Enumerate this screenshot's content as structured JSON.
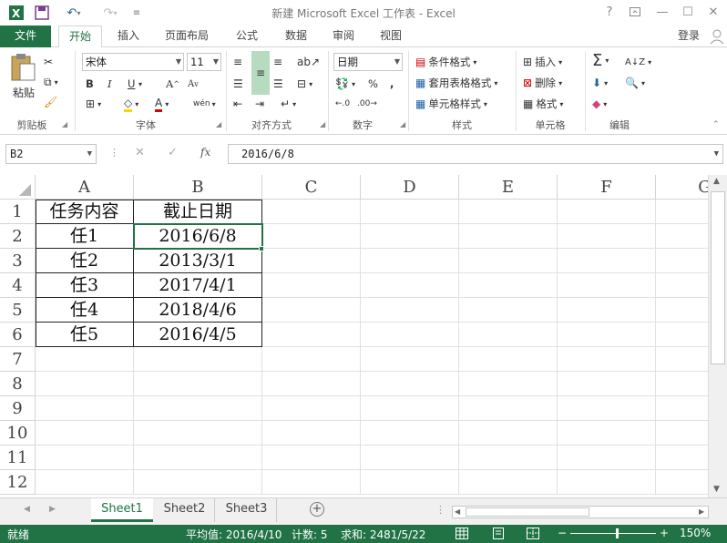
{
  "title": "新建 Microsoft Excel 工作表 - Excel",
  "quick_access": {
    "excel_icon": "excel-logo-icon",
    "save_icon": "save-icon",
    "undo_icon": "undo-icon",
    "redo_icon": "redo-icon",
    "customize_icon": "customize-icon"
  },
  "window_controls": {
    "help": "?",
    "ribbon_display": "ribbon-display-icon",
    "minimize": "minimize-icon",
    "maximize": "maximize-icon",
    "close": "close-icon"
  },
  "tabs": [
    "文件",
    "开始",
    "插入",
    "页面布局",
    "公式",
    "数据",
    "审阅",
    "视图"
  ],
  "login": "登录",
  "ribbon": {
    "clipboard": {
      "paste": "粘贴",
      "label": "剪贴板"
    },
    "font": {
      "name": "宋体",
      "size": "11",
      "bold": "B",
      "italic": "I",
      "underline": "U",
      "grow": "A",
      "shrink": "A",
      "label": "字体"
    },
    "alignment": {
      "label": "对齐方式"
    },
    "number": {
      "format": "日期",
      "label": "数字",
      "percent": "%",
      "comma": ","
    },
    "styles": {
      "conditional": "条件格式",
      "table": "套用表格格式",
      "cell_styles": "单元格样式",
      "label": "样式"
    },
    "cells": {
      "insert": "插入",
      "delete": "删除",
      "format": "格式",
      "label": "单元格"
    },
    "editing": {
      "label": "编辑"
    }
  },
  "formula_bar": {
    "name_box": "B2",
    "fx": "fx",
    "value": "2016/6/8"
  },
  "columns": [
    "A",
    "B",
    "C",
    "D",
    "E",
    "F",
    "G"
  ],
  "rows": [
    "1",
    "2",
    "3",
    "4",
    "5",
    "6",
    "7",
    "8",
    "9",
    "10",
    "11",
    "12"
  ],
  "table": {
    "headers": [
      "任务内容",
      "截止日期"
    ],
    "data": [
      [
        "任1",
        "2016/6/8"
      ],
      [
        "任2",
        "2013/3/1"
      ],
      [
        "任3",
        "2017/4/1"
      ],
      [
        "任4",
        "2018/4/6"
      ],
      [
        "任5",
        "2016/4/5"
      ]
    ]
  },
  "sheets": [
    "Sheet1",
    "Sheet2",
    "Sheet3"
  ],
  "status": {
    "ready": "就绪",
    "average": "平均值: 2016/4/10",
    "count": "计数: 5",
    "sum": "求和: 2481/5/22",
    "zoom": "150%"
  },
  "colors": {
    "accent": "#217346"
  }
}
